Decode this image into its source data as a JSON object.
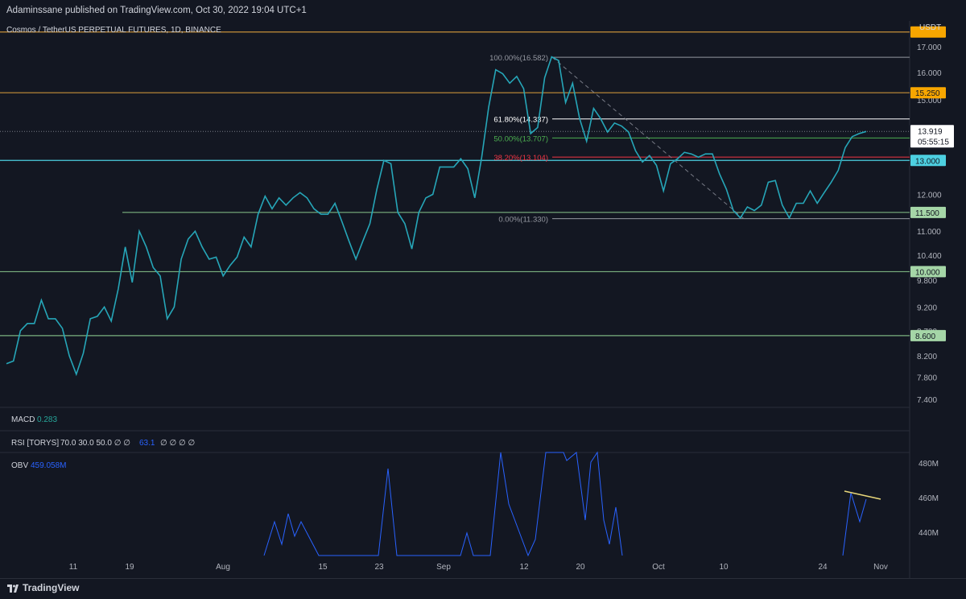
{
  "header": {
    "published": "Adaminssane published on TradingView.com, Oct 30, 2022 19:04 UTC+1"
  },
  "chart_title": "Cosmos / TetherUS PERPETUAL FUTURES, 1D, BINANCE",
  "currency": "USDT",
  "price_axis_labels": [
    "17.000",
    "16.000",
    "15.000",
    "14.000",
    "13.000",
    "12.000",
    "11.000",
    "10.400",
    "9.800",
    "9.200",
    "8.700",
    "8.200",
    "7.800",
    "7.400"
  ],
  "levels": [
    {
      "value": 17.6,
      "label": "",
      "color": "#f7a600",
      "line": "#c8913a"
    },
    {
      "value": 15.25,
      "label": "15.250",
      "color": "#f7a600",
      "line": "#c8913a"
    },
    {
      "value": 13.0,
      "label": "13.000",
      "color": "#4dd0e1",
      "line": "#4dd0e1"
    },
    {
      "value": 11.5,
      "label": "11.500",
      "color": "#a5d6a7",
      "line": "#7bb27f"
    },
    {
      "value": 10.0,
      "label": "10.000",
      "color": "#a5d6a7",
      "line": "#7bb27f"
    },
    {
      "value": 8.6,
      "label": "8.600",
      "color": "#a5d6a7",
      "line": "#7bb27f"
    }
  ],
  "fib": [
    {
      "label": "100.00%(16.582)",
      "value": 16.582,
      "color": "#9598a1"
    },
    {
      "label": "61.80%(14.337)",
      "value": 14.337,
      "color": "#ffffff"
    },
    {
      "label": "50.00%(13.707)",
      "value": 13.707,
      "color": "#4caf50"
    },
    {
      "label": "38.20%(13.104)",
      "value": 13.104,
      "color": "#f23645"
    },
    {
      "label": "0.00%(11.330)",
      "value": 11.33,
      "color": "#9598a1"
    }
  ],
  "current_price": {
    "value": "13.919",
    "countdown": "05:55:15"
  },
  "x_labels": [
    "11",
    "19",
    "Aug",
    "15",
    "23",
    "Sep",
    "12",
    "20",
    "Oct",
    "10",
    "24",
    "Nov"
  ],
  "macd": {
    "label": "MACD",
    "value": "0.283"
  },
  "rsi": {
    "label": "RSI [TORYS]",
    "params": "70.0  30.0  50.0  ∅  ∅",
    "value": "63.1",
    "tail": "∅  ∅  ∅  ∅"
  },
  "obv": {
    "label": "OBV",
    "value": "459.058M",
    "axis": [
      "480M",
      "460M",
      "440M"
    ]
  },
  "footer": {
    "brand": "TradingView"
  },
  "chart_data": {
    "type": "line",
    "title": "Cosmos / TetherUS PERPETUAL FUTURES, 1D, BINANCE",
    "series": [
      {
        "values": [
          8.05,
          8.1,
          8.7,
          8.85,
          8.85,
          9.35,
          8.95,
          8.95,
          8.75,
          8.2,
          7.85,
          8.25,
          8.95,
          9.0,
          9.2,
          8.9,
          9.6,
          10.6,
          9.75,
          11.0,
          10.6,
          10.1,
          9.9,
          8.95,
          9.2,
          10.3,
          10.8,
          11.0,
          10.6,
          10.3,
          10.35,
          9.9,
          10.15,
          10.35,
          10.85,
          10.6,
          11.45,
          11.95,
          11.6,
          11.9,
          11.7,
          11.9,
          12.05,
          11.9,
          11.6,
          11.45,
          11.45,
          11.75,
          11.25,
          10.75,
          10.3,
          10.75,
          11.2,
          12.15,
          13.0,
          12.9,
          11.5,
          11.2,
          10.55,
          11.5,
          11.9,
          12.0,
          12.8,
          12.8,
          12.8,
          13.05,
          12.75,
          11.9,
          13.1,
          14.75,
          16.1,
          15.95,
          15.6,
          15.85,
          15.4,
          13.85,
          14.05,
          15.8,
          16.6,
          16.45,
          14.9,
          15.6,
          14.35,
          13.6,
          14.7,
          14.35,
          13.9,
          14.2,
          14.1,
          13.9,
          13.3,
          12.95,
          13.15,
          12.85,
          12.1,
          12.9,
          13.05,
          13.25,
          13.2,
          13.1,
          13.2,
          13.2,
          12.6,
          12.15,
          11.55,
          11.35,
          11.65,
          11.55,
          11.7,
          12.35,
          12.4,
          11.7,
          11.35,
          11.75,
          11.75,
          12.1,
          11.75,
          12.05,
          12.35,
          12.7,
          13.4,
          13.75,
          13.85,
          13.919
        ]
      }
    ],
    "x_ticks": [
      "11",
      "19",
      "Aug",
      "15",
      "23",
      "Sep",
      "12",
      "20",
      "Oct",
      "10",
      "24",
      "Nov"
    ],
    "ylim": [
      7.2,
      17.8
    ],
    "obv_series": [
      440,
      465,
      460,
      470,
      462,
      455,
      440,
      435,
      480,
      470,
      478,
      455,
      440,
      455,
      460
    ]
  }
}
